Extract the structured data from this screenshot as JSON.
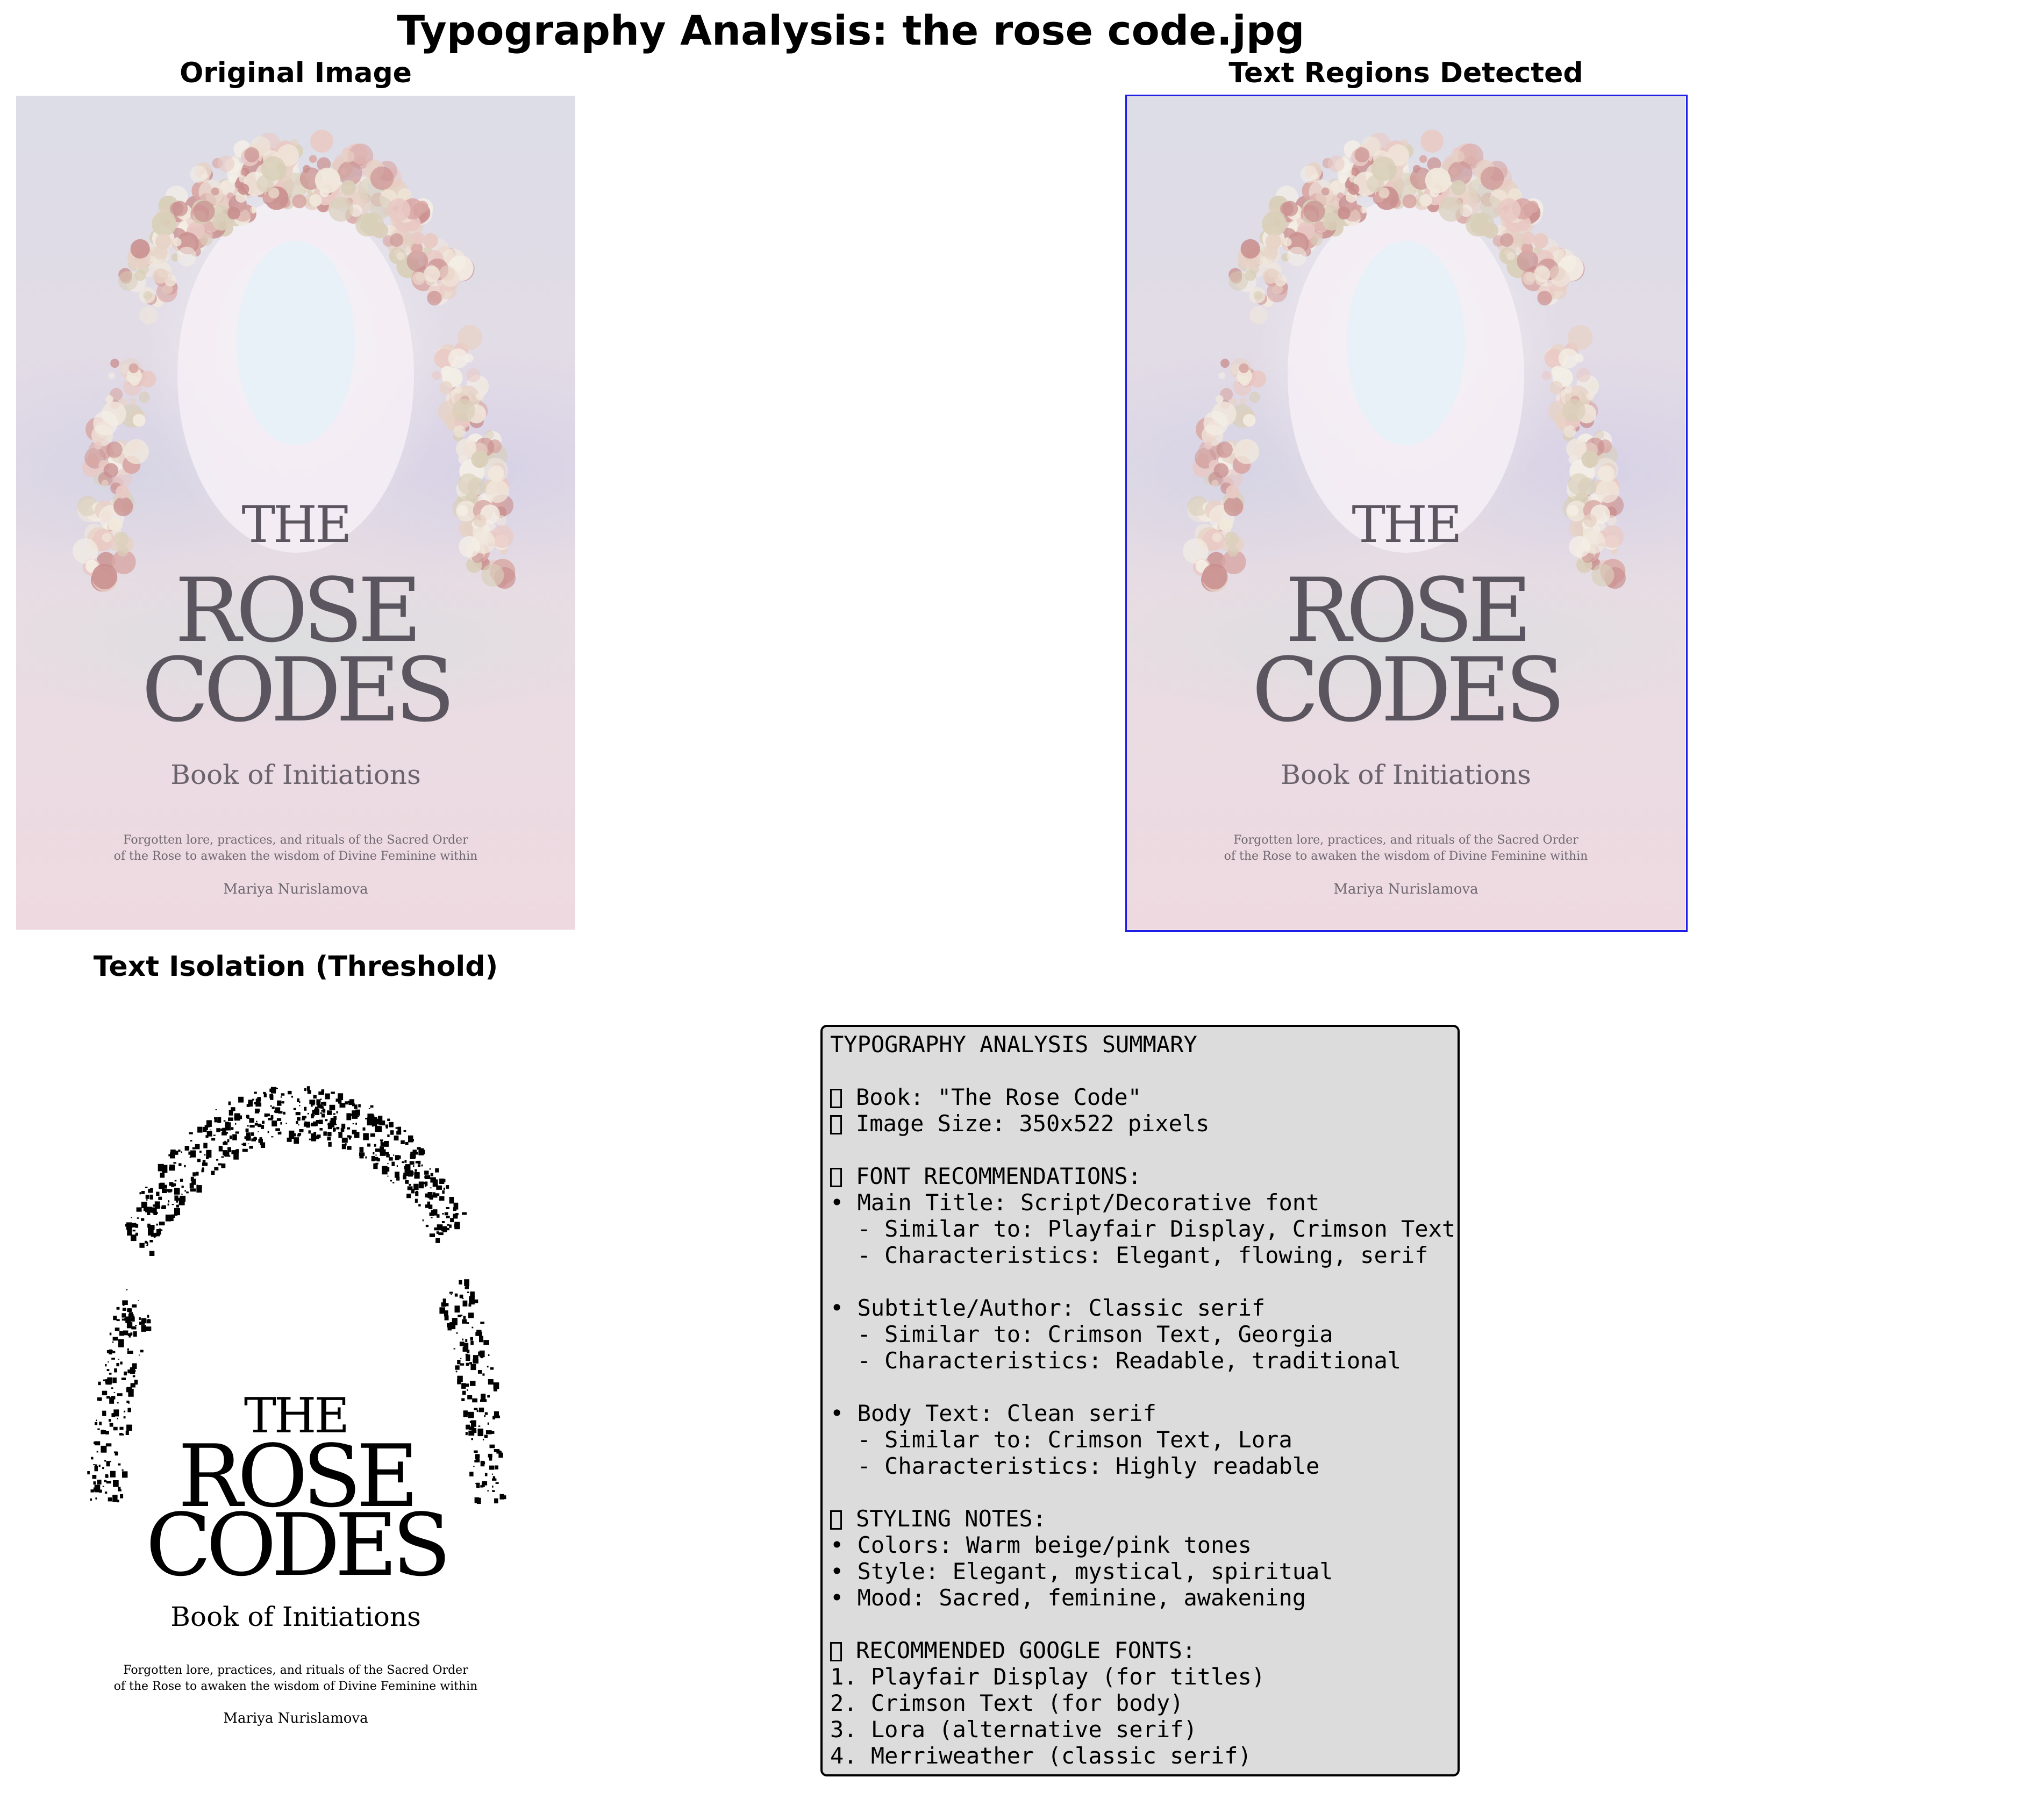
{
  "figure_title": "Typography Analysis: the rose code.jpg",
  "panels": {
    "original": {
      "title": "Original Image"
    },
    "regions": {
      "title": "Text Regions Detected",
      "box_color": "#1e1ee6"
    },
    "threshold": {
      "title": "Text Isolation (Threshold)"
    }
  },
  "cover": {
    "title_the": "THE",
    "title_rose": "ROSE",
    "title_codes": "CODES",
    "subtitle": "Book of Initiations",
    "description_line1": "Forgotten lore, practices, and rituals of the Sacred Order",
    "description_line2": "of the Rose to awaken the wisdom of Divine Feminine within",
    "author": "Mariya Nurislamova"
  },
  "summary": {
    "lines": [
      {
        "icon": false,
        "text": "TYPOGRAPHY ANALYSIS SUMMARY"
      },
      {
        "icon": false,
        "text": ""
      },
      {
        "icon": true,
        "text": "Book: \"The Rose Code\""
      },
      {
        "icon": true,
        "text": "Image Size: 350x522 pixels"
      },
      {
        "icon": false,
        "text": ""
      },
      {
        "icon": true,
        "text": "FONT RECOMMENDATIONS:"
      },
      {
        "icon": false,
        "text": "• Main Title: Script/Decorative font"
      },
      {
        "icon": false,
        "text": "  - Similar to: Playfair Display, Crimson Text"
      },
      {
        "icon": false,
        "text": "  - Characteristics: Elegant, flowing, serif"
      },
      {
        "icon": false,
        "text": ""
      },
      {
        "icon": false,
        "text": "• Subtitle/Author: Classic serif"
      },
      {
        "icon": false,
        "text": "  - Similar to: Crimson Text, Georgia"
      },
      {
        "icon": false,
        "text": "  - Characteristics: Readable, traditional"
      },
      {
        "icon": false,
        "text": ""
      },
      {
        "icon": false,
        "text": "• Body Text: Clean serif"
      },
      {
        "icon": false,
        "text": "  - Similar to: Crimson Text, Lora"
      },
      {
        "icon": false,
        "text": "  - Characteristics: Highly readable"
      },
      {
        "icon": false,
        "text": ""
      },
      {
        "icon": true,
        "text": "STYLING NOTES:"
      },
      {
        "icon": false,
        "text": "• Colors: Warm beige/pink tones"
      },
      {
        "icon": false,
        "text": "• Style: Elegant, mystical, spiritual"
      },
      {
        "icon": false,
        "text": "• Mood: Sacred, feminine, awakening"
      },
      {
        "icon": false,
        "text": ""
      },
      {
        "icon": true,
        "text": "RECOMMENDED GOOGLE FONTS:"
      },
      {
        "icon": false,
        "text": "1. Playfair Display (for titles)"
      },
      {
        "icon": false,
        "text": "2. Crimson Text (for body)"
      },
      {
        "icon": false,
        "text": "3. Lora (alternative serif)"
      },
      {
        "icon": false,
        "text": "4. Merriweather (classic serif)"
      }
    ]
  }
}
